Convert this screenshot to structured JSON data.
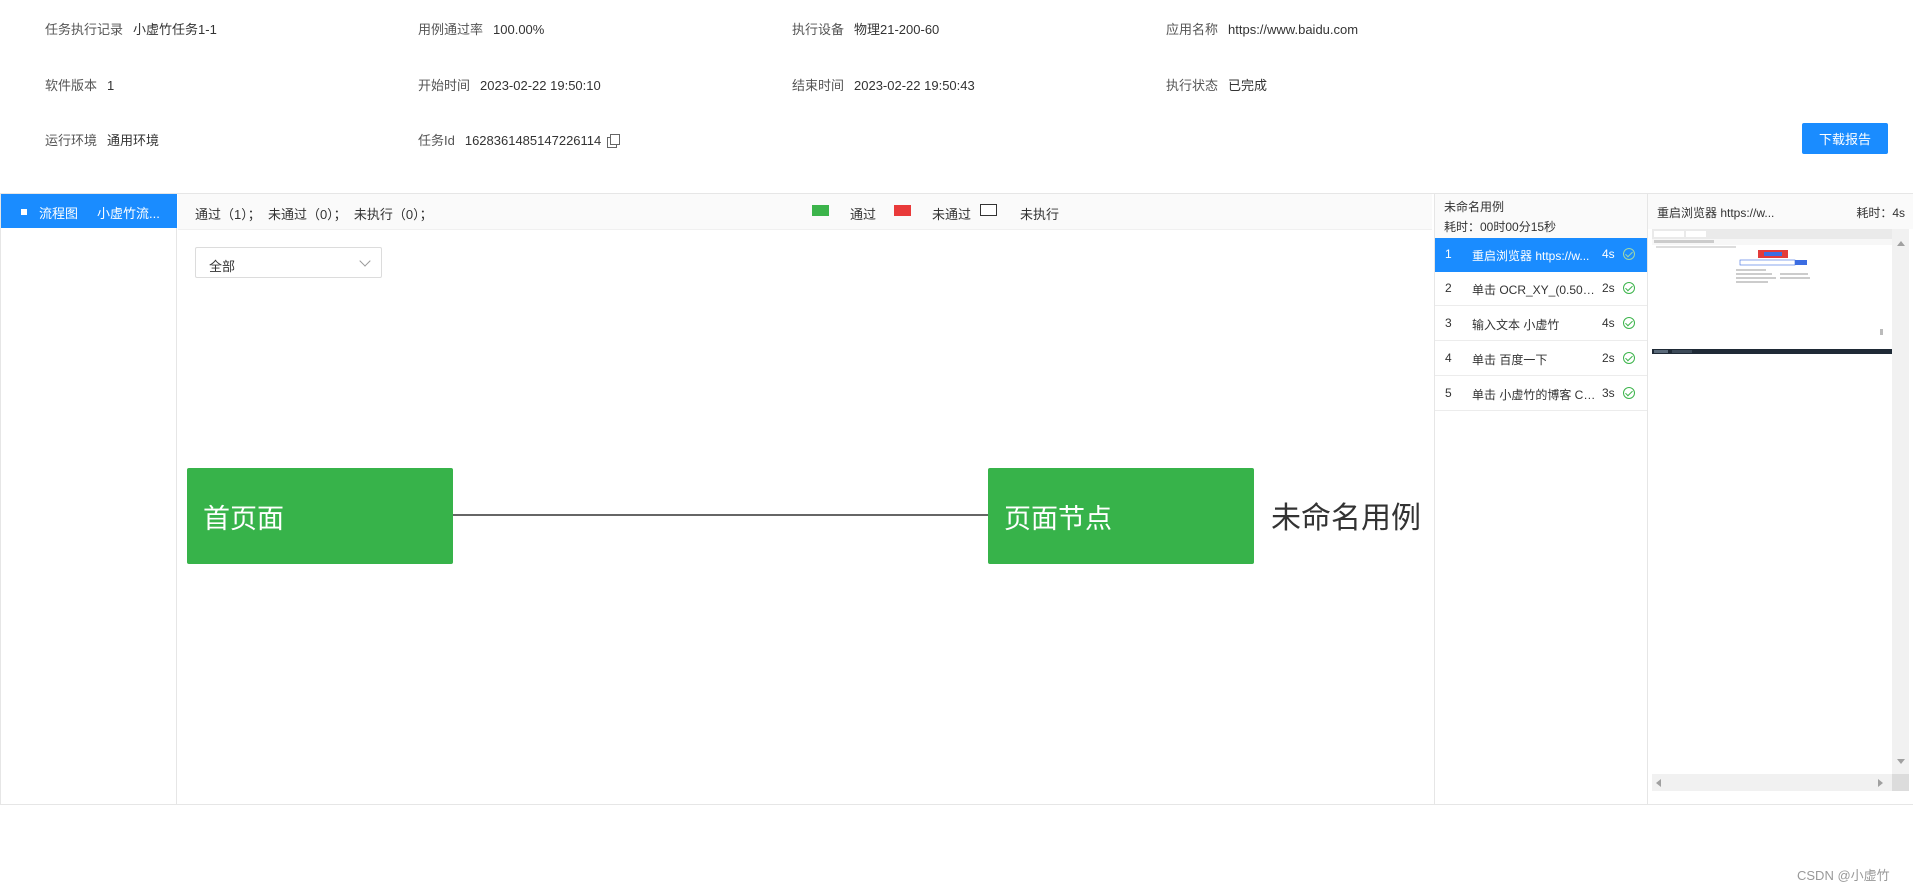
{
  "task_info": {
    "row1": [
      {
        "label": "任务执行记录",
        "value": "小虚竹任务1-1"
      },
      {
        "label": "用例通过率",
        "value": "100.00%"
      },
      {
        "label": "执行设备",
        "value": "物理21-200-60"
      },
      {
        "label": "应用名称",
        "value": "https://www.baidu.com"
      }
    ],
    "row2": [
      {
        "label": "软件版本",
        "value": "1"
      },
      {
        "label": "开始时间",
        "value": "2023-02-22 19:50:10"
      },
      {
        "label": "结束时间",
        "value": "2023-02-22 19:50:43"
      },
      {
        "label": "执行状态",
        "value": "已完成"
      }
    ],
    "row3": [
      {
        "label": "运行环境",
        "value": "通用环境"
      },
      {
        "label": "任务Id",
        "value": "1628361485147226114"
      }
    ]
  },
  "download_button": "下载报告",
  "left_nav": {
    "label": "流程图",
    "name": "小虚竹流..."
  },
  "stats": {
    "text": "通过（1）；  未通过（0）；  未执行（0）；"
  },
  "legend": {
    "pass": {
      "label": "通过",
      "color": "#3cb44b"
    },
    "fail": {
      "label": "未通过",
      "color": "#e93a3a"
    },
    "not_run": {
      "label": "未执行",
      "color": "#ffffff"
    }
  },
  "filter": {
    "value": "全部"
  },
  "flow": {
    "node1": "首页面",
    "node2": "页面节点",
    "case_label": "未命名用例",
    "node_color": "#37b34a"
  },
  "case_panel": {
    "title": "未命名用例",
    "time": "耗时：00时00分15秒",
    "steps": [
      {
        "num": "1",
        "name": "重启浏览器 https://w...",
        "duration": "4s",
        "status": "pass"
      },
      {
        "num": "2",
        "name": "单击 OCR_XY_(0.501,0...",
        "duration": "2s",
        "status": "pass"
      },
      {
        "num": "3",
        "name": "输入文本 小虚竹",
        "duration": "4s",
        "status": "pass"
      },
      {
        "num": "4",
        "name": "单击 百度一下",
        "duration": "2s",
        "status": "pass"
      },
      {
        "num": "5",
        "name": "单击 小虚竹的博客 CS...",
        "duration": "3s",
        "status": "pass"
      }
    ]
  },
  "screenshot_panel": {
    "title": "重启浏览器 https://w...",
    "time": "耗时：4s"
  },
  "watermark": "CSDN @小虚竹"
}
